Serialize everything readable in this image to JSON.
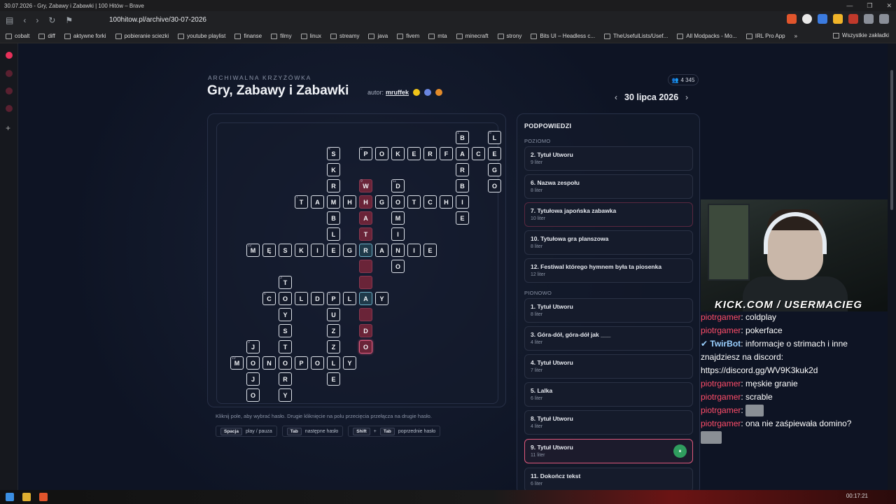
{
  "browser": {
    "window_title": "30.07.2026 - Gry, Zabawy i Zabawki | 100 Hitów – Brave",
    "url": "100hitow.pl/archive/30-07-2026",
    "bookmarks": [
      "cobalt",
      "diff",
      "aktywne forki",
      "pobieranie sciezki",
      "youtube playlist",
      "finanse",
      "filmy",
      "linux",
      "streamy",
      "java",
      "fivem",
      "mta",
      "minecraft",
      "strony",
      "Bits UI – Headless c...",
      "TheUsefulLists/Usef...",
      "All Modpacks - Mo...",
      "IRL Pro App"
    ],
    "bookmarks_more": "»",
    "bookmarks_all": "Wszystkie zakładki"
  },
  "header": {
    "subtitle": "ARCHIWALNA KRZYŻÓWKA",
    "title": "Gry, Zabawy i Zabawki",
    "author_label": "autor:",
    "author_name": "mruffek",
    "players": "4 345",
    "date": "30 lipca 2026"
  },
  "grid": {
    "cells": [
      {
        "r": 0,
        "c": 13,
        "ch": "B",
        "num": "1"
      },
      {
        "r": 0,
        "c": 15,
        "ch": "L",
        "num": "8"
      },
      {
        "r": 1,
        "c": 5,
        "ch": "S",
        "num": "4"
      },
      {
        "r": 1,
        "c": 7,
        "ch": "P",
        "num": "2"
      },
      {
        "r": 1,
        "c": 8,
        "ch": "O"
      },
      {
        "r": 1,
        "c": 9,
        "ch": "K"
      },
      {
        "r": 1,
        "c": 10,
        "ch": "E"
      },
      {
        "r": 1,
        "c": 11,
        "ch": "R"
      },
      {
        "r": 1,
        "c": 12,
        "ch": "F"
      },
      {
        "r": 1,
        "c": 13,
        "ch": "A"
      },
      {
        "r": 1,
        "c": 14,
        "ch": "C"
      },
      {
        "r": 1,
        "c": 15,
        "ch": "E"
      },
      {
        "r": 2,
        "c": 5,
        "ch": "K"
      },
      {
        "r": 2,
        "c": 13,
        "ch": "R"
      },
      {
        "r": 2,
        "c": 15,
        "ch": "G"
      },
      {
        "r": 3,
        "c": 5,
        "ch": "R"
      },
      {
        "r": 3,
        "c": 7,
        "ch": "W",
        "num": "9",
        "st": "hl"
      },
      {
        "r": 3,
        "c": 9,
        "ch": "D",
        "num": "11"
      },
      {
        "r": 3,
        "c": 13,
        "ch": "B"
      },
      {
        "r": 3,
        "c": 15,
        "ch": "O"
      },
      {
        "r": 4,
        "c": 3,
        "ch": "T",
        "num": "7"
      },
      {
        "r": 4,
        "c": 4,
        "ch": "A"
      },
      {
        "r": 4,
        "c": 5,
        "ch": "M"
      },
      {
        "r": 4,
        "c": 6,
        "ch": "H"
      },
      {
        "r": 4,
        "c": 7,
        "ch": "H",
        "st": "hl"
      },
      {
        "r": 4,
        "c": 8,
        "ch": "G"
      },
      {
        "r": 4,
        "c": 9,
        "ch": "O"
      },
      {
        "r": 4,
        "c": 10,
        "ch": "T"
      },
      {
        "r": 4,
        "c": 11,
        "ch": "C"
      },
      {
        "r": 4,
        "c": 12,
        "ch": "H"
      },
      {
        "r": 4,
        "c": 13,
        "ch": "I"
      },
      {
        "r": 5,
        "c": 5,
        "ch": "B"
      },
      {
        "r": 5,
        "c": 7,
        "ch": "A",
        "st": "hl"
      },
      {
        "r": 5,
        "c": 9,
        "ch": "M"
      },
      {
        "r": 5,
        "c": 13,
        "ch": "E"
      },
      {
        "r": 6,
        "c": 5,
        "ch": "L"
      },
      {
        "r": 6,
        "c": 7,
        "ch": "T",
        "st": "hl"
      },
      {
        "r": 6,
        "c": 9,
        "ch": "I"
      },
      {
        "r": 7,
        "c": 0,
        "ch": "M",
        "num": "12"
      },
      {
        "r": 7,
        "c": 1,
        "ch": "Ę"
      },
      {
        "r": 7,
        "c": 2,
        "ch": "S"
      },
      {
        "r": 7,
        "c": 3,
        "ch": "K"
      },
      {
        "r": 7,
        "c": 4,
        "ch": "I"
      },
      {
        "r": 7,
        "c": 5,
        "ch": "E"
      },
      {
        "r": 7,
        "c": 6,
        "ch": "G"
      },
      {
        "r": 7,
        "c": 7,
        "ch": "R",
        "st": "act"
      },
      {
        "r": 7,
        "c": 8,
        "ch": "A"
      },
      {
        "r": 7,
        "c": 9,
        "ch": "N"
      },
      {
        "r": 7,
        "c": 10,
        "ch": "I"
      },
      {
        "r": 7,
        "c": 11,
        "ch": "E"
      },
      {
        "r": 8,
        "c": 7,
        "ch": "",
        "st": "hl"
      },
      {
        "r": 8,
        "c": 9,
        "ch": "O"
      },
      {
        "r": 9,
        "c": 2,
        "ch": "T",
        "num": "3"
      },
      {
        "r": 9,
        "c": 7,
        "ch": "",
        "st": "hl"
      },
      {
        "r": 10,
        "c": 1,
        "ch": "C",
        "num": "6"
      },
      {
        "r": 10,
        "c": 2,
        "ch": "O"
      },
      {
        "r": 10,
        "c": 3,
        "ch": "L"
      },
      {
        "r": 10,
        "c": 4,
        "ch": "D"
      },
      {
        "r": 10,
        "c": 5,
        "ch": "P",
        "num": "5"
      },
      {
        "r": 10,
        "c": 6,
        "ch": "L"
      },
      {
        "r": 10,
        "c": 7,
        "ch": "A",
        "st": "act"
      },
      {
        "r": 10,
        "c": 8,
        "ch": "Y"
      },
      {
        "r": 11,
        "c": 2,
        "ch": "Y"
      },
      {
        "r": 11,
        "c": 5,
        "ch": "U"
      },
      {
        "r": 11,
        "c": 7,
        "ch": "",
        "st": "hl"
      },
      {
        "r": 12,
        "c": 2,
        "ch": "S"
      },
      {
        "r": 12,
        "c": 5,
        "ch": "Z"
      },
      {
        "r": 12,
        "c": 7,
        "ch": "D",
        "st": "hl"
      },
      {
        "r": 13,
        "c": 0,
        "ch": "J",
        "num": "3"
      },
      {
        "r": 13,
        "c": 2,
        "ch": "T"
      },
      {
        "r": 13,
        "c": 5,
        "ch": "Z"
      },
      {
        "r": 13,
        "c": 7,
        "ch": "O",
        "st": "cur"
      },
      {
        "r": 14,
        "c": -1,
        "ch": "M",
        "num": "10"
      },
      {
        "r": 14,
        "c": 0,
        "ch": "O"
      },
      {
        "r": 14,
        "c": 1,
        "ch": "N"
      },
      {
        "r": 14,
        "c": 2,
        "ch": "O"
      },
      {
        "r": 14,
        "c": 3,
        "ch": "P"
      },
      {
        "r": 14,
        "c": 4,
        "ch": "O"
      },
      {
        "r": 14,
        "c": 5,
        "ch": "L"
      },
      {
        "r": 14,
        "c": 6,
        "ch": "Y"
      },
      {
        "r": 15,
        "c": 0,
        "ch": "J"
      },
      {
        "r": 15,
        "c": 2,
        "ch": "R"
      },
      {
        "r": 15,
        "c": 5,
        "ch": "E"
      },
      {
        "r": 16,
        "c": 0,
        "ch": "O"
      },
      {
        "r": 16,
        "c": 2,
        "ch": "Y"
      }
    ]
  },
  "help": {
    "text": "Kliknij pole, aby wybrać hasło. Drugie kliknięcie na polu przecięcia przełącza na drugie hasło.",
    "keys": [
      {
        "k1": "Spacja",
        "k2": "",
        "label": "play / pauza"
      },
      {
        "k1": "Tab",
        "k2": "",
        "label": "następne hasło"
      },
      {
        "k1": "Shift",
        "k2": "Tab",
        "label": "poprzednie hasło"
      }
    ]
  },
  "clues": {
    "title": "PODPOWIEDZI",
    "across_label": "POZIOMO",
    "down_label": "PIONOWO",
    "across": [
      {
        "t": "2. Tytuł Utworu",
        "l": "9 liter"
      },
      {
        "t": "6. Nazwa zespołu",
        "l": "8 liter"
      },
      {
        "t": "7. Tytułowa japońska zabawka",
        "l": "10 liter"
      },
      {
        "t": "10. Tytułowa gra planszowa",
        "l": "8 liter"
      },
      {
        "t": "12. Festiwal którego hymnem była ta piosenka",
        "l": "12 liter"
      }
    ],
    "down": [
      {
        "t": "1. Tytuł Utworu",
        "l": "8 liter"
      },
      {
        "t": "3. Góra-dół, góra-dół jak ___",
        "l": "4 liter"
      },
      {
        "t": "4. Tytuł Utworu",
        "l": "7 liter"
      },
      {
        "t": "5. Lalka",
        "l": "6 liter"
      },
      {
        "t": "8. Tytuł Utworu",
        "l": "4 liter"
      },
      {
        "t": "9. Tytuł Utworu",
        "l": "11 liter"
      },
      {
        "t": "11. Dokończ tekst",
        "l": "6 liter"
      }
    ],
    "play_icon": "⏸"
  },
  "stream": {
    "overlay": "KICK.COM / USERMACIEG",
    "chat": [
      {
        "user": "piotrgamer",
        "msg": "coldplay"
      },
      {
        "user": "piotrgamer",
        "msg": "pokerface"
      },
      {
        "user": "TwirBot",
        "msg": "informacje o strimach i inne znajdziesz na discord: https://discord.gg/WV9K3kuk2d",
        "bot": true
      },
      {
        "user": "piotrgamer",
        "msg": "męskie granie"
      },
      {
        "user": "piotrgamer",
        "msg": "scrable"
      },
      {
        "user": "piotrgamer",
        "msg": "",
        "emote": true
      },
      {
        "user": "piotrgamer",
        "msg": "ona nie zaśpiewała domino?"
      }
    ]
  },
  "taskbar": {
    "time": "00:17:21"
  }
}
